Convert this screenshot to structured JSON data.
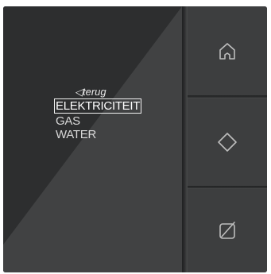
{
  "screen": {
    "back_label": "◁terug",
    "menu_items": [
      "ELEKTRICITEIT",
      "GAS",
      "WATER"
    ],
    "selected_index": 0
  },
  "buttons": [
    {
      "icon": "home-icon"
    },
    {
      "icon": "diamond-icon"
    },
    {
      "icon": "slash-box-icon"
    }
  ],
  "colors": {
    "panel": "#3d3e3f",
    "screen": "#2f3031",
    "text": "#d8d8d8",
    "highlight": "#ffffff"
  }
}
